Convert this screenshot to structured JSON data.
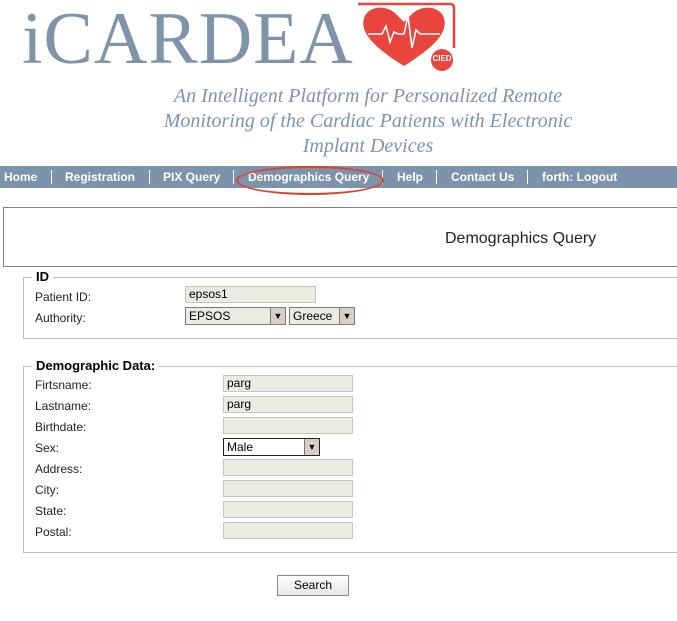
{
  "header": {
    "logo_text": "iCARDEA",
    "badge_text": "CIED",
    "tagline_line1": "An Intelligent Platform for Personalized Remote",
    "tagline_line2": "Monitoring of the Cardiac Patients with Electronic",
    "tagline_line3": "Implant Devices"
  },
  "nav": {
    "home": "Home",
    "registration": "Registration",
    "pix_query": "PIX Query",
    "demographics_query": "Demographics Query",
    "help": "Help",
    "contact_us": "Contact Us",
    "logout": "forth: Logout"
  },
  "page": {
    "title": "Demographics Query"
  },
  "id_section": {
    "legend": "ID",
    "patient_id_label": "Patient ID:",
    "patient_id_value": "epsos1",
    "authority_label": "Authority:",
    "authority_value": "EPSOS",
    "country_value": "Greece"
  },
  "demo_section": {
    "legend": "Demographic Data:",
    "firstname_label": "Firtsname:",
    "firstname_value": "parg",
    "lastname_label": "Lastname:",
    "lastname_value": "parg",
    "birthdate_label": "Birthdate:",
    "birthdate_value": "",
    "sex_label": "Sex:",
    "sex_value": "Male",
    "address_label": "Address:",
    "address_value": "",
    "city_label": "City:",
    "city_value": "",
    "state_label": "State:",
    "state_value": "",
    "postal_label": "Postal:",
    "postal_value": ""
  },
  "search_button": "Search",
  "colors": {
    "nav_bg": "#7d93ab",
    "logo": "#7f93a9",
    "heart": "#e8453c",
    "highlight": "#d9452b"
  }
}
